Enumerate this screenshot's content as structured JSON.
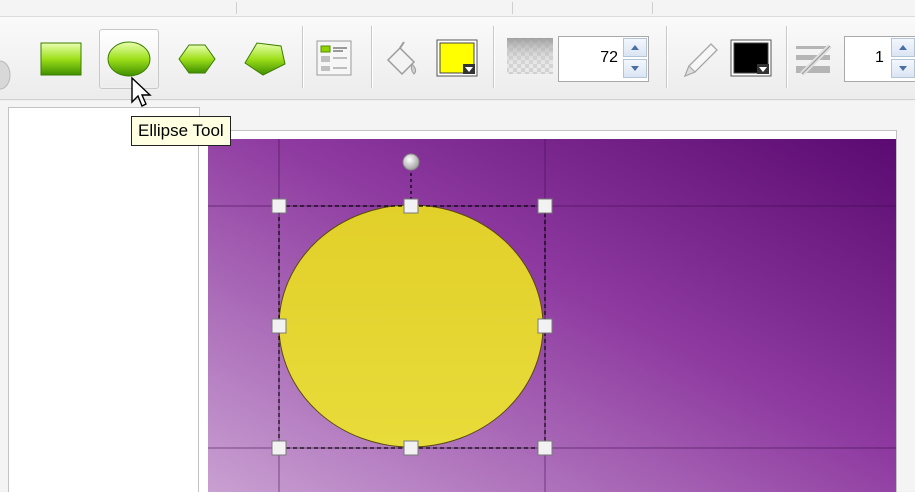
{
  "tooltip": {
    "text": "Ellipse Tool"
  },
  "toolbar": {
    "tools": [
      {
        "name": "rectangle-tool"
      },
      {
        "name": "ellipse-tool",
        "hovered": true
      },
      {
        "name": "hexagon-tool"
      },
      {
        "name": "pentagon-tool"
      }
    ],
    "fill_color": "#ffff00",
    "opacity_value": "72",
    "stroke_color": "#000000",
    "stroke_width_value": "1"
  },
  "colors": {
    "accent_green": "#8fd400",
    "canvas_gradient_start": "#c08ac8",
    "canvas_gradient_end": "#66107a",
    "shape_fill": "#e6d62e",
    "handle": "#f2f2f2"
  }
}
